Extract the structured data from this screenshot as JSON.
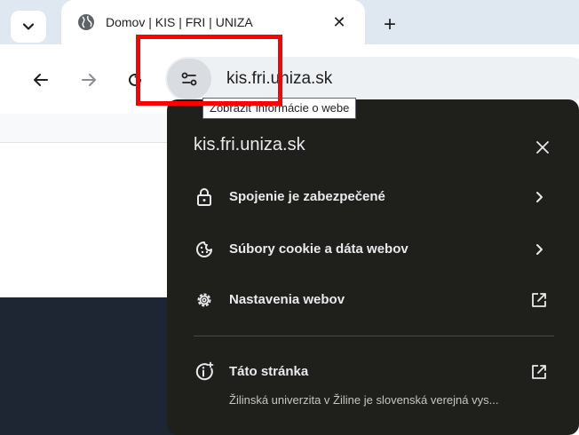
{
  "tab": {
    "title": "Domov | KIS | FRI | UNIZA",
    "close_symbol": "✕",
    "new_tab_symbol": "+",
    "menu_icon": "chevron-down-icon",
    "favicon_icon": "globe-icon"
  },
  "toolbar": {
    "back_icon": "arrow-left-icon",
    "forward_icon": "arrow-right-icon",
    "reload_icon": "reload-icon",
    "url": "kis.fri.uniza.sk",
    "site_info_icon": "tune-icon",
    "tooltip": "Zobraziť informácie o webe"
  },
  "popup": {
    "title": "kis.fri.uniza.sk",
    "close_icon": "close-icon",
    "items": [
      {
        "label": "Spojenie je zabezpečené",
        "icon": "lock-icon",
        "action_icon": "chevron-right-icon"
      },
      {
        "label": "Súbory cookie a dáta webov",
        "icon": "cookie-icon",
        "action_icon": "chevron-right-icon"
      },
      {
        "label": "Nastavenia webov",
        "icon": "gear-icon",
        "action_icon": "open-external-icon"
      }
    ],
    "this_page": {
      "label": "Táto stránka",
      "description": "Žilinská univerzita v Žiline je slovenská verejná vys...",
      "icon": "info-sparkle-icon",
      "action_icon": "open-external-icon"
    }
  },
  "colors": {
    "tabstrip_bg": "#dfe8f0",
    "popup_bg": "#1f1f1b",
    "highlight": "#ff0000"
  }
}
